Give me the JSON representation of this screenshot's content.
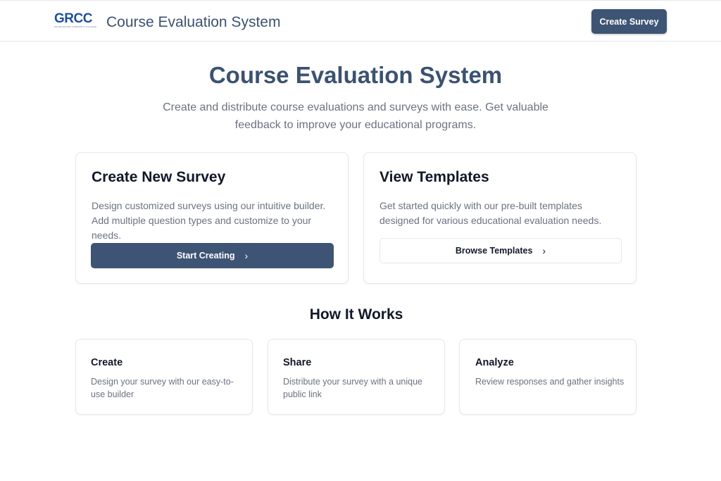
{
  "header": {
    "logo_text": "GRCC",
    "logo_subtext": "GRAND RAPIDS COMMUNITY COLLEGE",
    "app_title": "Course Evaluation System",
    "create_survey_label": "Create Survey"
  },
  "hero": {
    "title": "Course Evaluation System",
    "subtitle": "Create and distribute course evaluations and surveys with ease. Get valuable feedback to improve your educational programs."
  },
  "cards": {
    "create": {
      "title": "Create New Survey",
      "description": "Design customized surveys using our intuitive builder. Add multiple question types and customize to your needs.",
      "button_label": "Start Creating"
    },
    "templates": {
      "title": "View Templates",
      "description": "Get started quickly with our pre-built templates designed for various educational evaluation needs.",
      "button_label": "Browse Templates"
    }
  },
  "how_it_works": {
    "title": "How It Works",
    "steps": [
      {
        "title": "Create",
        "description": "Design your survey with our easy-to-use builder"
      },
      {
        "title": "Share",
        "description": "Distribute your survey with a unique public link"
      },
      {
        "title": "Analyze",
        "description": "Review responses and gather insights"
      }
    ]
  },
  "icons": {
    "chevron": "chevron-right-icon"
  },
  "colors": {
    "primary": "#3e5474",
    "title": "#3b5270",
    "logo": "#1e4f9c"
  }
}
